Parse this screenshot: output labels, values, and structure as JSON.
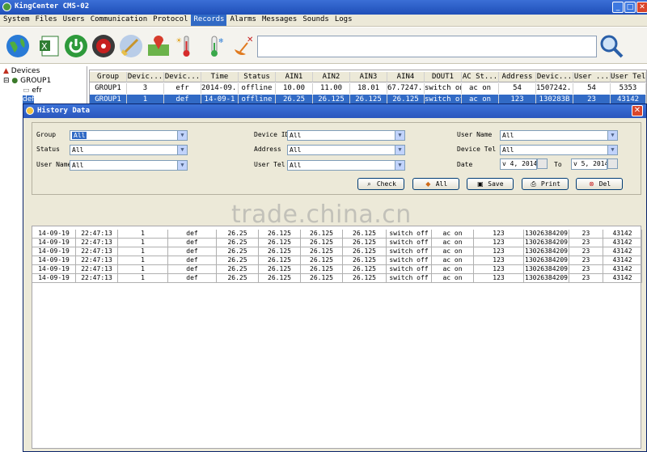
{
  "window": {
    "title": "KingCenter CMS-02",
    "min": "_",
    "max": "□",
    "close": "✕"
  },
  "menu": [
    "System",
    "Files",
    "Users",
    "Communication",
    "Protocol",
    "Records",
    "Alarms",
    "Messages",
    "Sounds",
    "Logs"
  ],
  "toolbar_icons": [
    "globe-icon",
    "excel-icon",
    "power-icon",
    "record-icon",
    "broom-icon",
    "map-pin-icon",
    "temperature-icon",
    "thermometer-icon",
    "satellite-icon",
    "search-icon"
  ],
  "tree": {
    "root": "Devices",
    "group": "GROUP1",
    "device1": "efr",
    "device2": "def"
  },
  "grid": {
    "columns": [
      "Group",
      "Devic...",
      "Devic...",
      "Time",
      "Status",
      "AIN1",
      "AIN2",
      "AIN3",
      "AIN4",
      "DOUT1",
      "AC St...",
      "Address",
      "Devic...",
      "User ...",
      "User Tel"
    ],
    "rows": [
      [
        "GROUP1",
        "3",
        "efr",
        "2014-09...",
        "offline",
        "10.00",
        "11.00",
        "18.01",
        "67.7247...",
        "switch on",
        "ac on",
        "54",
        "1507242...",
        "54",
        "5353"
      ],
      [
        "GROUP1",
        "1",
        "def",
        "14-09-1",
        "offline",
        "26.25",
        "26.125",
        "26.125",
        "26.125",
        "switch off",
        "ac on",
        "123",
        "130283B",
        "23",
        "43142"
      ]
    ]
  },
  "dialog": {
    "title": "History Data",
    "fields": {
      "group": {
        "label": "Group",
        "value": "All"
      },
      "status": {
        "label": "Status",
        "value": "All"
      },
      "user_name_1": {
        "label": "User Name",
        "value": "All"
      },
      "device_id": {
        "label": "Device ID",
        "value": "All"
      },
      "address": {
        "label": "Address",
        "value": "All"
      },
      "user_tel": {
        "label": "User Tel",
        "value": "All"
      },
      "user_name_2": {
        "label": "User Name",
        "value": "All"
      },
      "device_tel": {
        "label": "Device Tel",
        "value": "All"
      },
      "date": {
        "label": "Date",
        "from": "v 4, 2014",
        "to_label": "To",
        "to": "v 5, 2014"
      }
    },
    "buttons": {
      "check": "Check",
      "all": "All",
      "save": "Save",
      "print": "Print",
      "del": "Del"
    },
    "results": [
      [
        "14-09-19",
        "22:47:13",
        "1",
        "def",
        "26.25",
        "26.125",
        "26.125",
        "26.125",
        "switch off",
        "ac on",
        "123",
        "13026384209",
        "23",
        "43142"
      ],
      [
        "14-09-19",
        "22:47:13",
        "1",
        "def",
        "26.25",
        "26.125",
        "26.125",
        "26.125",
        "switch off",
        "ac on",
        "123",
        "13026384209",
        "23",
        "43142"
      ],
      [
        "14-09-19",
        "22:47:13",
        "1",
        "def",
        "26.25",
        "26.125",
        "26.125",
        "26.125",
        "switch off",
        "ac on",
        "123",
        "13026384209",
        "23",
        "43142"
      ],
      [
        "14-09-19",
        "22:47:13",
        "1",
        "def",
        "26.25",
        "26.125",
        "26.125",
        "26.125",
        "switch off",
        "ac on",
        "123",
        "13026384209",
        "23",
        "43142"
      ],
      [
        "14-09-19",
        "22:47:13",
        "1",
        "def",
        "26.25",
        "26.125",
        "26.125",
        "26.125",
        "switch off",
        "ac on",
        "123",
        "13026384209",
        "23",
        "43142"
      ],
      [
        "14-09-19",
        "22:47:13",
        "1",
        "def",
        "26.25",
        "26.125",
        "26.125",
        "26.125",
        "switch off",
        "ac on",
        "123",
        "13026384209",
        "23",
        "43142"
      ]
    ]
  },
  "watermark": "trade.china.cn",
  "colors": {
    "titlebar": "#2a56bd",
    "selection": "#316ac5",
    "dialog_bg": "#ece9d8"
  }
}
